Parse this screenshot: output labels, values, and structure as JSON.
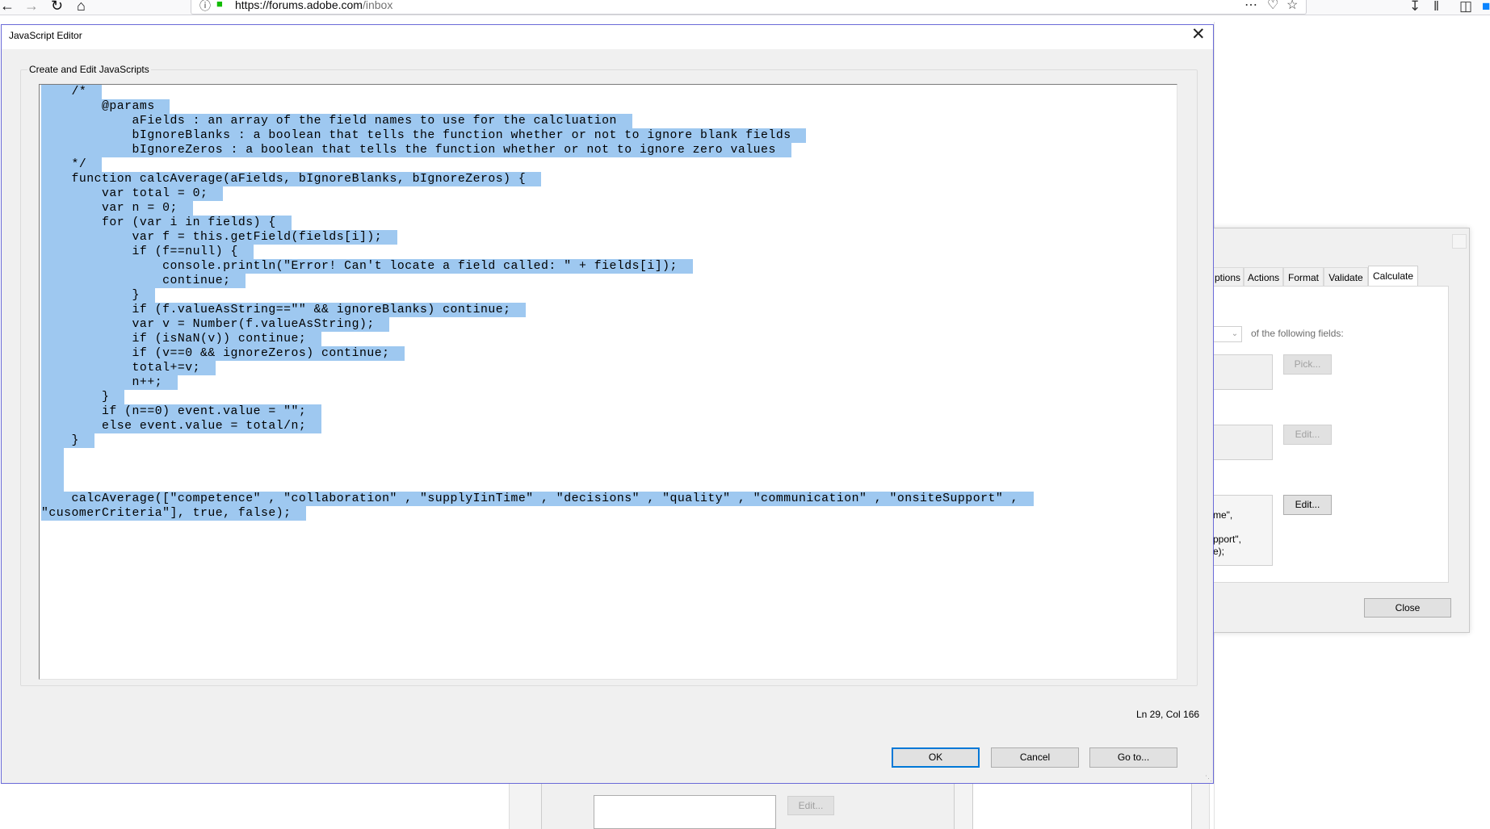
{
  "browser": {
    "url_domain": "https://forums.adobe.com",
    "url_path": "/inbox"
  },
  "field_properties": {
    "tabs": [
      "ptions",
      "Actions",
      "Format",
      "Validate",
      "Calculate"
    ],
    "of_following_fields_label": "of the following fields:",
    "pick_label": "Pick...",
    "edit_label_1": "Edit...",
    "edit_label_2": "Edit...",
    "snippet_1": "me\",",
    "snippet_2": "pport\",",
    "snippet_3": "e);",
    "close_label": "Close"
  },
  "background_page": {
    "edit_label": "Edit..."
  },
  "js_editor": {
    "title": "JavaScript Editor",
    "group_label": "Create and Edit JavaScripts",
    "code_lines": [
      "    /*",
      "        @params",
      "            aFields : an array of the field names to use for the calcluation",
      "            bIgnoreBlanks : a boolean that tells the function whether or not to ignore blank fields",
      "            bIgnoreZeros : a boolean that tells the function whether or not to ignore zero values",
      "    */",
      "    function calcAverage(aFields, bIgnoreBlanks, bIgnoreZeros) {",
      "        var total = 0;",
      "        var n = 0;",
      "        for (var i in fields) {",
      "            var f = this.getField(fields[i]);",
      "            if (f==null) {",
      "                console.println(\"Error! Can't locate a field called: \" + fields[i]);",
      "                continue;",
      "            }",
      "            if (f.valueAsString==\"\" && ignoreBlanks) continue;",
      "            var v = Number(f.valueAsString);",
      "            if (isNaN(v)) continue;",
      "            if (v==0 && ignoreZeros) continue;",
      "            total+=v;",
      "            n++;",
      "        }",
      "        if (n==0) event.value = \"\";",
      "        else event.value = total/n;",
      "    }",
      " ",
      " ",
      " ",
      "    calcAverage([\"competence\" , \"collaboration\" , \"supplyIinTime\" , \"decisions\" , \"quality\" , \"communication\" , \"onsiteSupport\" ,",
      "\"cusomerCriteria\"], true, false);"
    ],
    "status": "Ln 29, Col 166",
    "ok_label": "OK",
    "cancel_label": "Cancel",
    "goto_label": "Go to..."
  }
}
